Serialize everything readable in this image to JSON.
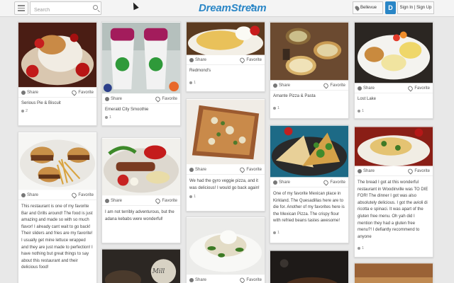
{
  "header": {
    "search_placeholder": "Search",
    "logo": "DreamStream",
    "location": "Bellevue",
    "brand_letter": "D",
    "sign_label": "Sign In | Sign Up"
  },
  "actions": {
    "share": "Share",
    "favorite": "Favorite"
  },
  "cards": {
    "c1": {
      "title": "Serious Pie & Biscuit",
      "likes": "2"
    },
    "c2": {
      "title": "Emerald City Smoothie",
      "likes": "1"
    },
    "c3": {
      "title": "Redmond's",
      "likes": "1"
    },
    "c4": {
      "title": "Amante Pizza & Pasta",
      "likes": "1"
    },
    "c5": {
      "title": "Lost Lake",
      "likes": "1"
    },
    "c6": {
      "desc": "This restaurant is one of my favorite Bar and Grills around! The food is just amazing and made so with so much flavor! I already cant wait to go back! Their sliders and fries are my favorite! I usually get mine lettuce wrapped and they are just made to perfection! I have nothing but great things to say about this restaurant and their delicious food!"
    },
    "c7": {
      "desc": "I am not terribly adventurous, but the adana kebabs were wonderful!"
    },
    "c8": {
      "desc": "We had the gyro veggie pizza, and it was delicious! I would go back again!",
      "likes": "1"
    },
    "c9": {
      "desc": "One of my favorite Mexican place in Kirkland. The Quesadillas here are to die for. Another of my favorites here is the Mexican Pizza. The crispy flour with refried beans tastes awesome!",
      "likes": "1"
    },
    "c10": {
      "desc": "The bread I got at this wonderful restaurant in Woodinville was TO DIE FOR! The dinner I got was also absolutely delicious. I got the avioli di ricotta e spinaci. It was apart of the gluten free menu. Oh yah did I mention they had a gluten free menu?! I defiantly recommend to anyone",
      "likes": "1"
    }
  },
  "colors": {
    "accent": "#2a86c6",
    "page_bg": "#e8e8e8"
  },
  "icons": [
    "menu-icon",
    "search-icon",
    "pin-icon",
    "share-icon",
    "heart-icon"
  ]
}
